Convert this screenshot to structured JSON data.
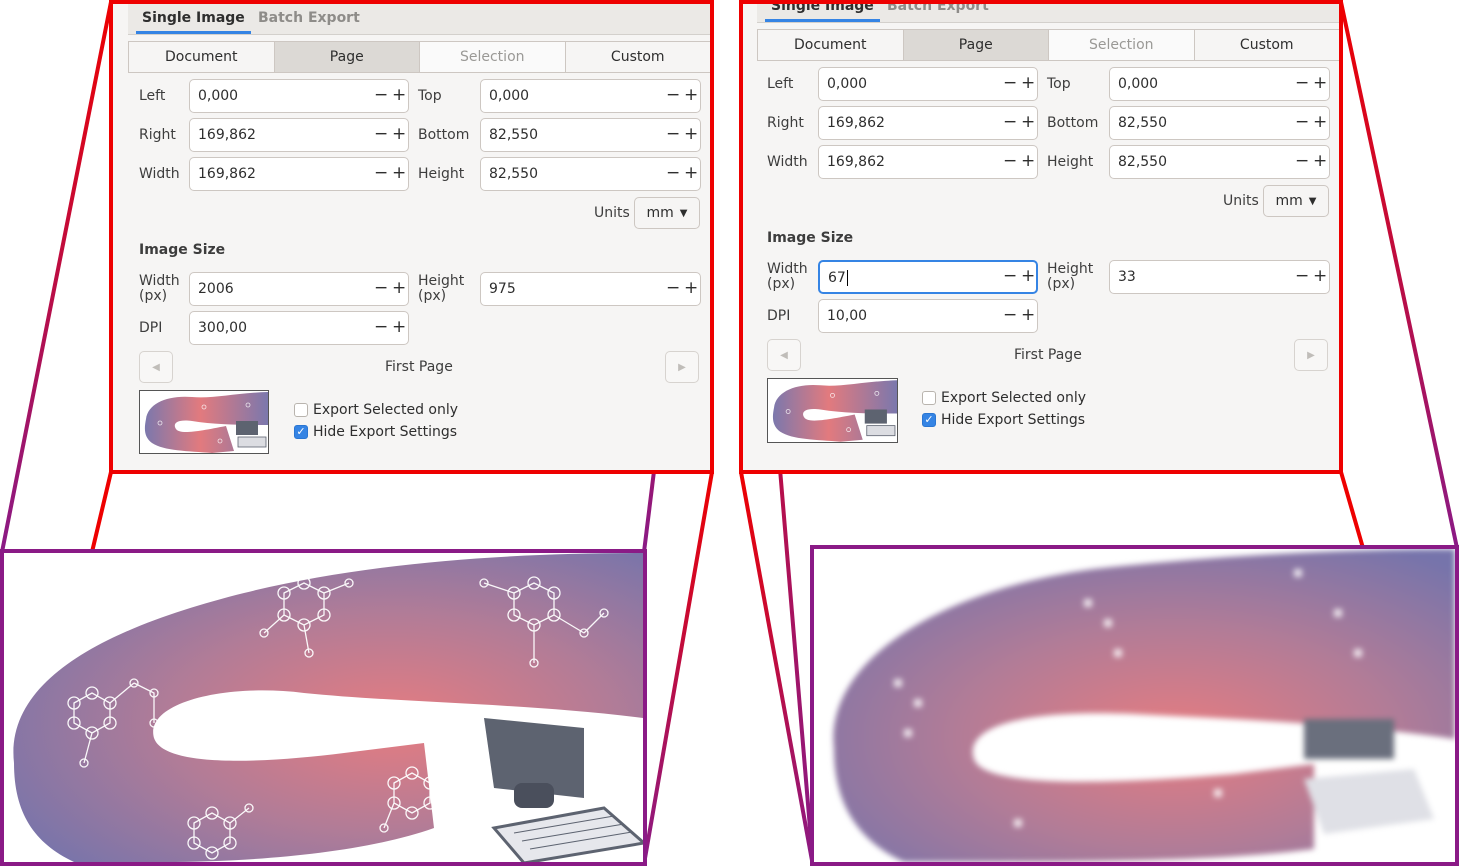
{
  "tabs": {
    "single_image": "Single Image",
    "batch_export": "Batch Export"
  },
  "area_buttons": [
    "Document",
    "Page",
    "Selection",
    "Custom"
  ],
  "area_selected": "Page",
  "fields": {
    "left_label": "Left",
    "left_value": "0,000",
    "top_label": "Top",
    "top_value": "0,000",
    "right_label": "Right",
    "right_value": "169,862",
    "bottom_label": "Bottom",
    "bottom_value": "82,550",
    "width_label": "Width",
    "width_value": "169,862",
    "height_label": "Height",
    "height_value": "82,550"
  },
  "units": {
    "label": "Units",
    "value": "mm"
  },
  "image_size": {
    "heading": "Image Size",
    "width_label_line1": "Width",
    "width_label_line2": "(px)",
    "height_label_line1": "Height",
    "height_label_line2": "(px)",
    "dpi_label": "DPI"
  },
  "left_panel": {
    "width_px": "2006",
    "height_px": "975",
    "dpi": "300,00"
  },
  "right_panel": {
    "width_px": "67",
    "height_px": "33",
    "dpi": "10,00"
  },
  "page_nav": {
    "label": "First Page"
  },
  "options": {
    "export_selected_only": "Export Selected only",
    "hide_export_settings": "Hide Export Settings",
    "export_selected_checked": false,
    "hide_export_checked": true
  },
  "colors": {
    "frame_red": "#ee0000",
    "frame_purple": "#8a1a86",
    "accent": "#3584e4",
    "gradient_start": "#e27a7e",
    "gradient_end": "#7b78ad"
  }
}
